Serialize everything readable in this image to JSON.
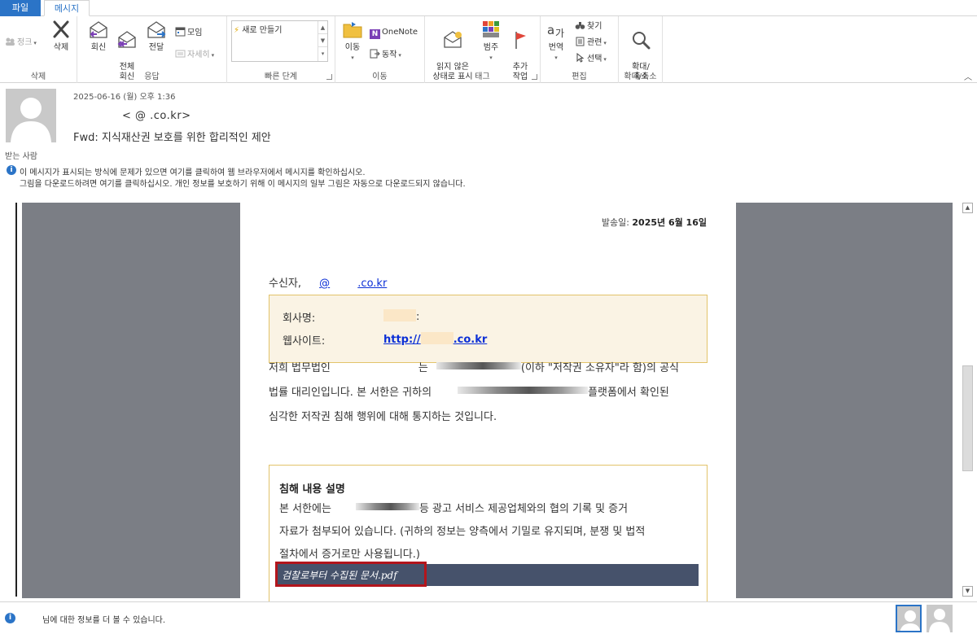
{
  "tabs": {
    "file": "파일",
    "message": "메시지"
  },
  "ribbon": {
    "delete_group": {
      "label": "삭제",
      "cleanup": "정크",
      "delete": "삭제"
    },
    "respond_group": {
      "label": "응답",
      "reply": "회신",
      "reply_all": "전체\n회신",
      "forward": "전달",
      "meeting": "모임",
      "more": "자세히"
    },
    "quicksteps_group": {
      "label": "빠른 단계",
      "new_item": "새로 만들기"
    },
    "move_group": {
      "label": "이동",
      "move": "이동",
      "onenote": "OneNote",
      "actions": "동작"
    },
    "tags_group": {
      "label": "태그",
      "unread": "읽지 않은\n상태로 표시",
      "categorize": "범주",
      "followup": "추가\n작업"
    },
    "editing_group": {
      "label": "편집",
      "translate": "번역",
      "find": "찾기",
      "related": "관련",
      "select": "선택"
    },
    "zoom_group": {
      "label": "확대/축소",
      "zoom": "확대/\n축소"
    }
  },
  "header": {
    "date": "2025-06-16 (월) 오후 1:36",
    "from": "<              @          .co.kr>",
    "subject": "Fwd: 지식재산권 보호를 위한 합리적인 제안",
    "to_label": "받는 사람",
    "info_line1": "이 메시지가 표시되는 방식에 문제가 있으면 여기를 클릭하여 웹 브라우저에서 메시지를 확인하십시오.",
    "info_line2": "그림을 다운로드하려면 여기를 클릭하십시오. 개인 정보를 보호하기 위해 이 메시지의 일부 그림은 자동으로 다운로드되지 않습니다."
  },
  "body": {
    "send_date_label": "발송일: ",
    "send_date_value": "2025년 6월 16일",
    "recipient_label": "수신자,",
    "recipient_at": "@",
    "recipient_domain": ".co.kr",
    "company_label": "회사명:",
    "company_colon": ":",
    "website_label": "웹사이트:",
    "website_prefix": "http://",
    "website_suffix": ".co.kr",
    "para1_line1_a": "저희 법무법인",
    "para1_line1_b": "는",
    "para1_line1_c": "(이하 \"저작권 소유자\"라 함)의 공식",
    "para1_line2_a": "법률 대리인입니다. 본 서한은 귀하의",
    "para1_line2_b": "플랫폼에서 확인된",
    "para1_line3": "심각한 저작권 침해 행위에 대해 통지하는 것입니다.",
    "infringe_title": "침해 내용 설명",
    "infringe_line1_a": "본 서한에는",
    "infringe_line1_b": "등 광고 서비스 제공업체와의 협의 기록 및 증거",
    "infringe_line2": "자료가 첨부되어 있습니다. (귀하의 정보는 양측에서 기밀로 유지되며, 분쟁 및 법적",
    "infringe_line3": "절차에서 증거로만 사용됩니다.)",
    "attachment": "검찰로부터 수집된 문서.pdf"
  },
  "footer": {
    "text": "님에 대한 정보를 더 볼 수 있습니다."
  },
  "colors": {
    "accent": "#2b74c7",
    "margin_gray": "#7b7e85",
    "box_border": "#e2c36a",
    "box_fill": "#faf3e4",
    "attach_bar": "#46526b",
    "highlight_red": "#b3151c"
  }
}
